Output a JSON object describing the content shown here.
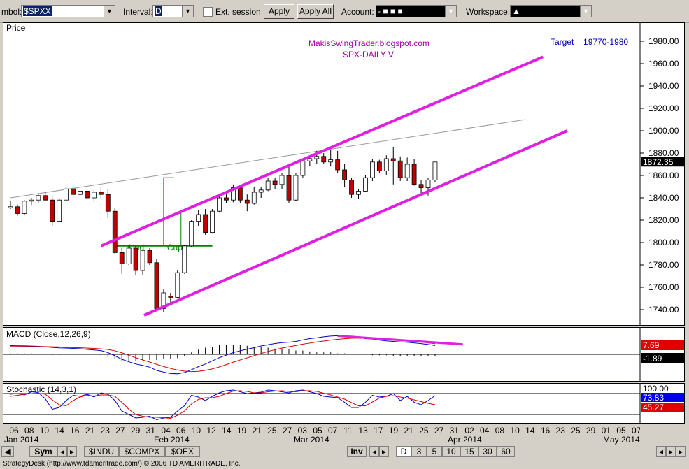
{
  "toolbar": {
    "symbol_label": "mbol:",
    "symbol_value": "$SPXX",
    "interval_label": "Interval:",
    "interval_value": "D",
    "ext_session_label": "Ext. session",
    "apply_label": "Apply",
    "apply_all_label": "Apply All",
    "account_label": "Account:",
    "account_value": "- ■ ■ ■",
    "workspace_label": "Workspace:",
    "workspace_value": "▲"
  },
  "tabs": {
    "sym": "Sym",
    "symbols": [
      "$INDU",
      "$COMPX",
      "$OEX"
    ],
    "inv": "Inv",
    "intervals": [
      "D",
      "3",
      "5",
      "10",
      "15",
      "30",
      "60"
    ]
  },
  "status_text": "StrategyDesk (http://www.tdameritrade.com/) © 2006 TD AMERITRADE, Inc.",
  "chart_data": [
    {
      "type": "candlestick",
      "title": "Price",
      "annotations": {
        "blog": "MakisSwingTrader.blogspot.com",
        "subtitle": "SPX-DAILY  V",
        "target": "Target = 19770-1980",
        "handle": "Hndl",
        "cup": "Cup"
      },
      "ylim": [
        1725,
        1990
      ],
      "y_ticks": [
        "1980.00",
        "1960.00",
        "1940.00",
        "1920.00",
        "1900.00",
        "1880.00",
        "1860.00",
        "1840.00",
        "1820.00",
        "1800.00",
        "1780.00",
        "1760.00",
        "1740.00"
      ],
      "y_tick_values": [
        1980,
        1960,
        1940,
        1920,
        1900,
        1880,
        1860,
        1840,
        1820,
        1800,
        1780,
        1760,
        1740
      ],
      "last_price": "1872.35",
      "last_value": 1872.35,
      "x_ticks": [
        "06",
        "08",
        "10",
        "14",
        "16",
        "21",
        "23",
        "27",
        "29",
        "31",
        "04",
        "06",
        "10",
        "12",
        "14",
        "19",
        "21",
        "25",
        "27",
        "03",
        "05",
        "07",
        "11",
        "13",
        "17",
        "19",
        "21",
        "25",
        "27",
        "31",
        "02",
        "04",
        "08",
        "10",
        "14",
        "16",
        "23",
        "25",
        "29",
        "01",
        "05",
        "07"
      ],
      "month_labels": [
        "Jan 2014",
        "Feb 2014",
        "Mar 2014",
        "Apr 2014",
        "May 2014"
      ],
      "ohlc": [
        [
          1831,
          1837,
          1830,
          1832
        ],
        [
          1832,
          1834,
          1824,
          1826
        ],
        [
          1826,
          1838,
          1825,
          1837
        ],
        [
          1837,
          1840,
          1833,
          1838
        ],
        [
          1838,
          1843,
          1835,
          1842
        ],
        [
          1842,
          1845,
          1837,
          1838
        ],
        [
          1838,
          1841,
          1815,
          1819
        ],
        [
          1819,
          1840,
          1818,
          1838
        ],
        [
          1838,
          1850,
          1837,
          1848
        ],
        [
          1848,
          1850,
          1840,
          1843
        ],
        [
          1843,
          1848,
          1842,
          1846
        ],
        [
          1846,
          1847,
          1839,
          1840
        ],
        [
          1840,
          1847,
          1836,
          1845
        ],
        [
          1845,
          1849,
          1840,
          1843
        ],
        [
          1843,
          1848,
          1822,
          1828
        ],
        [
          1828,
          1831,
          1790,
          1791
        ],
        [
          1791,
          1795,
          1772,
          1781
        ],
        [
          1781,
          1798,
          1780,
          1795
        ],
        [
          1795,
          1797,
          1771,
          1775
        ],
        [
          1775,
          1794,
          1771,
          1793
        ],
        [
          1793,
          1795,
          1780,
          1782
        ],
        [
          1782,
          1785,
          1739,
          1741
        ],
        [
          1741,
          1758,
          1738,
          1755
        ],
        [
          1752,
          1755,
          1745,
          1751
        ],
        [
          1751,
          1775,
          1750,
          1773
        ],
        [
          1773,
          1798,
          1772,
          1797
        ],
        [
          1797,
          1820,
          1796,
          1819
        ],
        [
          1819,
          1829,
          1815,
          1825
        ],
        [
          1825,
          1830,
          1807,
          1809
        ],
        [
          1809,
          1830,
          1808,
          1828
        ],
        [
          1828,
          1842,
          1827,
          1840
        ],
        [
          1840,
          1843,
          1835,
          1838
        ],
        [
          1838,
          1852,
          1836,
          1849
        ],
        [
          1849,
          1851,
          1835,
          1838
        ],
        [
          1838,
          1843,
          1828,
          1835
        ],
        [
          1835,
          1850,
          1834,
          1845
        ],
        [
          1845,
          1850,
          1840,
          1847
        ],
        [
          1847,
          1858,
          1846,
          1855
        ],
        [
          1855,
          1858,
          1848,
          1852
        ],
        [
          1852,
          1862,
          1848,
          1860
        ],
        [
          1860,
          1868,
          1835,
          1838
        ],
        [
          1838,
          1862,
          1837,
          1860
        ],
        [
          1860,
          1875,
          1858,
          1873
        ],
        [
          1873,
          1878,
          1868,
          1875
        ],
        [
          1875,
          1882,
          1870,
          1877
        ],
        [
          1877,
          1880,
          1870,
          1872
        ],
        [
          1872,
          1883,
          1868,
          1874
        ],
        [
          1874,
          1882,
          1862,
          1865
        ],
        [
          1865,
          1870,
          1850,
          1856
        ],
        [
          1856,
          1858,
          1840,
          1843
        ],
        [
          1843,
          1848,
          1839,
          1846
        ],
        [
          1846,
          1860,
          1845,
          1858
        ],
        [
          1858,
          1875,
          1855,
          1872
        ],
        [
          1872,
          1874,
          1862,
          1864
        ],
        [
          1864,
          1878,
          1860,
          1875
        ],
        [
          1875,
          1885,
          1852,
          1873
        ],
        [
          1873,
          1877,
          1855,
          1858
        ],
        [
          1858,
          1876,
          1855,
          1870
        ],
        [
          1870,
          1875,
          1851,
          1852
        ],
        [
          1852,
          1856,
          1842,
          1849
        ],
        [
          1849,
          1858,
          1842,
          1856
        ],
        [
          1856,
          1872,
          1854,
          1872
        ]
      ],
      "channel_color": "#e020e0"
    },
    {
      "type": "line",
      "title": "MACD (Close,12,26,9)",
      "series": [
        {
          "name": "MACD",
          "color": "#0000cc",
          "values": [
            9.2,
            9,
            8.9,
            8.7,
            8.4,
            8,
            7.2,
            6.8,
            6.6,
            6.2,
            5.9,
            5.2,
            4.6,
            3.9,
            1.8,
            -1.5,
            -5.2,
            -7.8,
            -10.2,
            -11.6,
            -13.5,
            -16.9,
            -18.7,
            -20.2,
            -20.5,
            -19.2,
            -16.2,
            -13,
            -10.2,
            -6.9,
            -3.5,
            -0.9,
            1.8,
            3.7,
            5.4,
            7,
            8.8,
            10.1,
            11.4,
            12.3,
            12.8,
            13.6,
            15.2,
            16.5,
            17.4,
            18.5,
            19.2,
            19.6,
            19.2,
            18.4,
            17.6,
            16.5,
            16.1,
            15,
            14.1,
            13.6,
            13,
            12.7,
            12,
            11.3,
            10.4,
            9.3
          ]
        },
        {
          "name": "Signal",
          "color": "#dd0000",
          "values": [
            8.2,
            8.2,
            8.3,
            8.2,
            8.2,
            8.2,
            8,
            7.8,
            7.4,
            7.1,
            6.9,
            6.6,
            6.2,
            5.8,
            5.1,
            3.7,
            1.6,
            -1,
            -3.5,
            -5.9,
            -8.1,
            -10.5,
            -12.8,
            -14.8,
            -16.5,
            -17.7,
            -18.2,
            -17.9,
            -16.9,
            -15.3,
            -13.3,
            -10.8,
            -8.2,
            -5.9,
            -3.7,
            -1.4,
            0.9,
            3,
            4.9,
            6.6,
            8,
            9.3,
            10.7,
            11.8,
            13,
            14,
            15,
            15.8,
            16.4,
            16.9,
            17,
            16.9,
            16.7,
            16.3,
            15.6,
            15.2,
            14.7,
            14.1,
            13.5,
            12.8,
            12,
            11.2
          ]
        }
      ],
      "histogram": [
        1,
        1,
        1,
        1,
        0,
        0,
        -1,
        -1,
        -1,
        -1,
        -1,
        -1,
        -1,
        -2,
        -3,
        -5,
        -7,
        -7,
        -7,
        -6,
        -6,
        -6,
        -5,
        -5,
        -4,
        -2,
        2,
        5,
        7,
        8,
        10,
        10,
        10,
        10,
        9,
        8,
        8,
        7,
        6,
        6,
        5,
        4,
        4,
        3,
        2,
        2,
        2,
        1,
        1,
        0,
        0,
        0,
        -1,
        -1,
        -1,
        -2,
        -2,
        -2,
        -2,
        -2,
        -2,
        -2
      ],
      "ylim": [
        -28,
        25
      ],
      "labels": [
        "7.69",
        "-1.89"
      ]
    },
    {
      "type": "line",
      "title": "Stochastic (14,3,1)",
      "series": [
        {
          "name": "%K",
          "color": "#0000cc",
          "values": [
            78,
            80,
            76,
            85,
            83,
            65,
            35,
            40,
            60,
            75,
            72,
            78,
            70,
            82,
            78,
            60,
            30,
            20,
            10,
            12,
            15,
            5,
            10,
            12,
            30,
            45,
            75,
            70,
            60,
            72,
            82,
            88,
            90,
            85,
            80,
            82,
            84,
            90,
            88,
            85,
            82,
            88,
            90,
            85,
            80,
            72,
            70,
            68,
            55,
            40,
            40,
            55,
            75,
            70,
            72,
            80,
            60,
            72,
            55,
            48,
            60,
            74
          ]
        },
        {
          "name": "%D",
          "color": "#dd0000",
          "values": [
            72,
            75,
            78,
            80,
            81,
            78,
            62,
            48,
            45,
            60,
            70,
            75,
            73,
            76,
            76,
            72,
            55,
            35,
            20,
            15,
            12,
            12,
            11,
            9,
            18,
            30,
            50,
            63,
            68,
            68,
            72,
            80,
            87,
            88,
            86,
            82,
            82,
            85,
            87,
            88,
            86,
            85,
            88,
            88,
            86,
            81,
            76,
            70,
            64,
            54,
            45,
            45,
            56,
            67,
            72,
            74,
            70,
            67,
            62,
            57,
            52,
            48
          ]
        }
      ],
      "ylim": [
        0,
        100
      ],
      "reference_lines": [
        80,
        20
      ],
      "labels": [
        "100.00",
        "73.83",
        "45.27"
      ]
    }
  ]
}
